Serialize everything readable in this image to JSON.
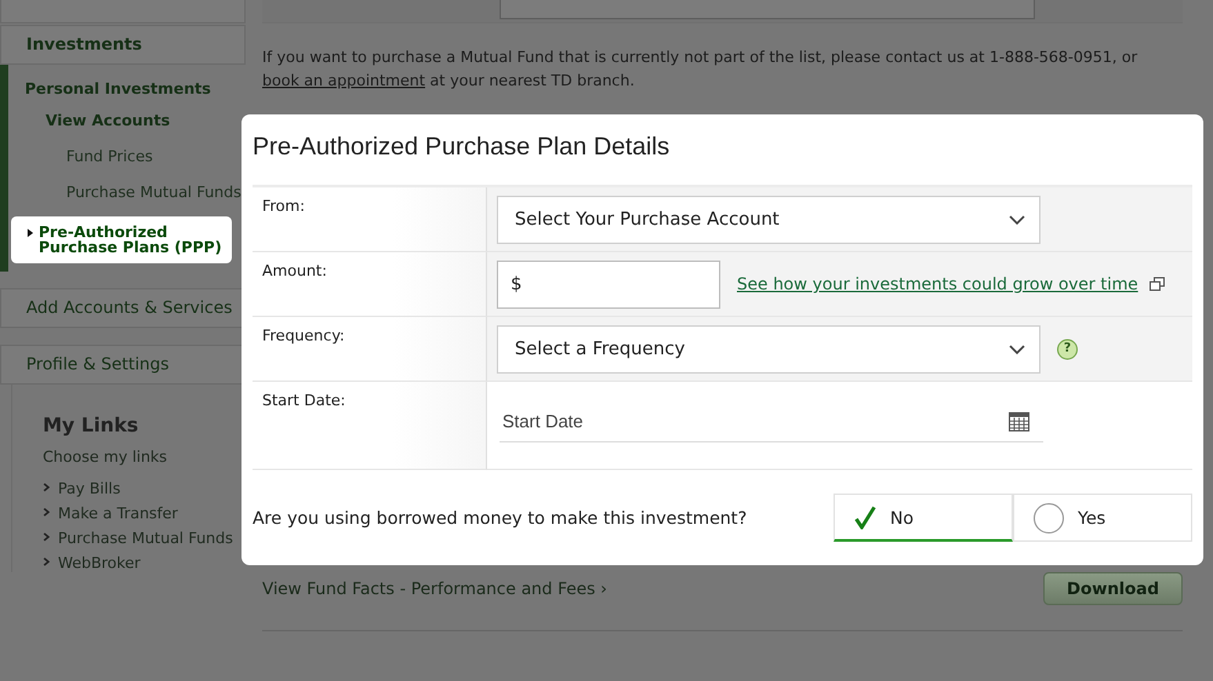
{
  "sidebar": {
    "sections": [
      {
        "title": "Investments",
        "tree": [
          {
            "label": "Personal Investments",
            "selected": false,
            "children": [
              {
                "label": "View Accounts",
                "selected": false,
                "children": [
                  {
                    "label": "Fund Prices",
                    "selected": false
                  },
                  {
                    "label": "Purchase Mutual Funds",
                    "selected": false
                  },
                  {
                    "label": "Pre-Authorized Purchase Plans (PPP)",
                    "selected": true
                  }
                ]
              }
            ]
          }
        ]
      },
      {
        "title": "Add Accounts & Services"
      },
      {
        "title": "Profile & Settings"
      }
    ],
    "my_links": {
      "title": "My Links",
      "subtitle": "Choose my links",
      "links": [
        "Pay Bills",
        "Make a Transfer",
        "Purchase Mutual Funds",
        "WebBroker"
      ]
    }
  },
  "main": {
    "notice": {
      "text_before": "If you want to purchase a Mutual Fund that is currently not part of the list, please contact us at 1-888-568-0951, or",
      "link": "book an appointment",
      "text_after": "at your nearest TD branch."
    },
    "fund_facts_link": "View Fund Facts - Performance and Fees ›",
    "download_button": "Download"
  },
  "modal": {
    "title": "Pre-Authorized Purchase Plan Details",
    "fields": [
      {
        "kind": "select",
        "label": "From:",
        "placeholder": "Select Your Purchase Account"
      },
      {
        "kind": "money",
        "label": "Amount:",
        "value": "$",
        "link": "See how your investments could grow over time"
      },
      {
        "kind": "select",
        "label": "Frequency:",
        "placeholder": "Select a Frequency",
        "help": "?"
      },
      {
        "kind": "date",
        "label": "Start Date:",
        "placeholder": "Start Date"
      }
    ],
    "question": "Are you using borrowed money to make this investment?",
    "options": [
      {
        "label": "No",
        "selected": true
      },
      {
        "label": "Yes",
        "selected": false
      }
    ]
  }
}
